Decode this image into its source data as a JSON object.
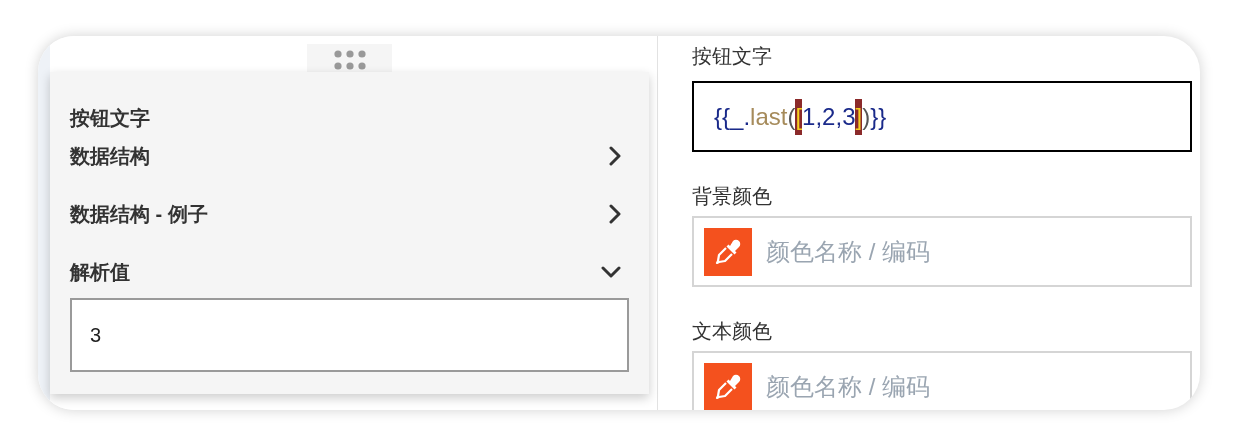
{
  "popup": {
    "title": "按钮文字",
    "sections": [
      {
        "label": "数据结构",
        "expanded": false
      },
      {
        "label": "数据结构 - 例子",
        "expanded": false
      },
      {
        "label": "解析值",
        "expanded": true,
        "value": "3"
      }
    ]
  },
  "editor": {
    "label": "按钮文字",
    "tokens": [
      {
        "text": "{{_",
        "kind": "variable"
      },
      {
        "text": ".",
        "kind": "variable"
      },
      {
        "text": "last",
        "kind": "method"
      },
      {
        "text": "(",
        "kind": "paren"
      },
      {
        "text": "[",
        "kind": "bracket"
      },
      {
        "text": "1,2,3",
        "kind": "variable"
      },
      {
        "text": "]",
        "kind": "bracket"
      },
      {
        "text": ")",
        "kind": "paren"
      },
      {
        "text": "}}",
        "kind": "variable"
      }
    ]
  },
  "color_fields": [
    {
      "label": "背景颜色",
      "placeholder": "颜色名称 / 编码"
    },
    {
      "label": "文本颜色",
      "placeholder": "颜色名称 / 编码"
    }
  ]
}
